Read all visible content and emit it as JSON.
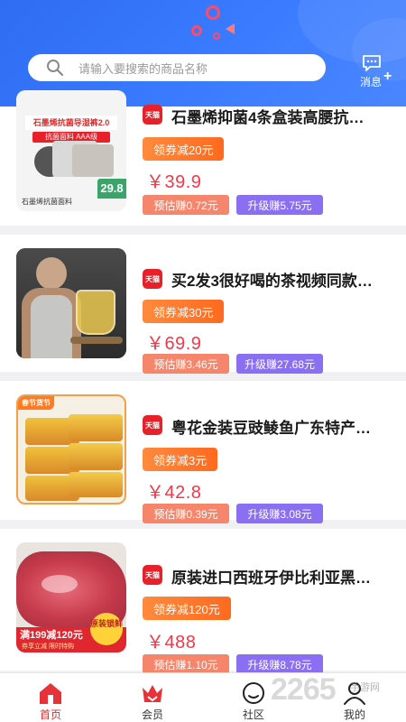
{
  "search": {
    "placeholder": "请输入要搜索的商品名称",
    "icon": "search-icon"
  },
  "header": {
    "message_label": "消息",
    "message_plus": "+",
    "accent": "#3a7bff"
  },
  "products": [
    {
      "badge": "天猫",
      "title": "石墨烯抑菌4条盒装高腰抗…",
      "coupon": "领券减20元",
      "price": "￥39.9",
      "estimate": "预估赚0.72元",
      "upgrade": "升级赚5.75元",
      "thumb": {
        "top_text": "石墨烯抗菌导湿裤2.0",
        "sub_text": "抗菌面料 AAA级",
        "foot_text": "石墨烯抗菌面料",
        "price_tag": "29.8"
      }
    },
    {
      "badge": "天猫",
      "title": "买2发3很好喝的茶视频同款…",
      "coupon": "领券减30元",
      "price": "￥69.9",
      "estimate": "预估赚3.46元",
      "upgrade": "升级赚27.68元"
    },
    {
      "badge": "天猫",
      "title": "粤花金装豆豉鲮鱼广东特产…",
      "coupon": "领券减3元",
      "price": "￥42.8",
      "estimate": "预估赚0.39元",
      "upgrade": "升级赚3.08元",
      "thumb": {
        "corner_text": "春节货节"
      }
    },
    {
      "badge": "天猫",
      "title": "原装进口西班牙伊比利亚黑…",
      "coupon": "领券减120元",
      "price": "￥488",
      "estimate": "预估赚1.10元",
      "upgrade": "升级赚8.78元",
      "thumb": {
        "banner_text": "满199减120元",
        "banner_sub": "券享立减 限时特购",
        "seal_text": "原装锁鲜"
      }
    }
  ],
  "tabs": [
    {
      "label": "首页",
      "icon": "home-icon",
      "active": true
    },
    {
      "label": "会员",
      "icon": "crown-icon",
      "active": false
    },
    {
      "label": "社区",
      "icon": "smile-icon",
      "active": false
    },
    {
      "label": "我的",
      "icon": "user-icon",
      "active": false
    }
  ],
  "watermark": {
    "text": "2265",
    "sub": "手游网"
  }
}
